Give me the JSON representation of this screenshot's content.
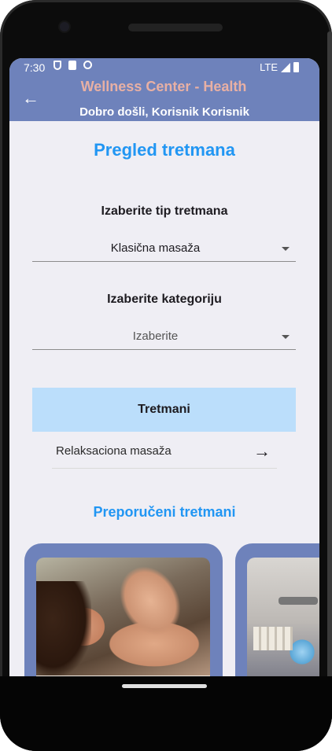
{
  "status_bar": {
    "time": "7:30",
    "network": "LTE",
    "icons": [
      "shield-icon",
      "sim-card-icon",
      "sync-icon",
      "signal-icon",
      "battery-icon"
    ]
  },
  "app_bar": {
    "title": "Wellness Center - Health",
    "subtitle": "Dobro došli, Korisnik Korisnik",
    "back_icon": "arrow-left-icon",
    "background_color": "#6e82bb",
    "title_color": "#e8b0a4"
  },
  "page": {
    "title": "Pregled tretmana",
    "accent_color": "#2196f3"
  },
  "treatment_type": {
    "label": "Izaberite tip tretmana",
    "selected": "Klasična masaža"
  },
  "category": {
    "label": "Izaberite kategoriju",
    "selected": "Izaberite"
  },
  "treatments": {
    "header": "Tretmani",
    "header_color": "#bbdefb",
    "items": [
      {
        "label": "Relaksaciona masaža",
        "icon": "arrow-right-icon"
      }
    ]
  },
  "recommended": {
    "title": "Preporučeni tretmani",
    "cards": [
      {
        "image": "massage-photo"
      },
      {
        "image": "spa-treatment-photo"
      }
    ]
  }
}
